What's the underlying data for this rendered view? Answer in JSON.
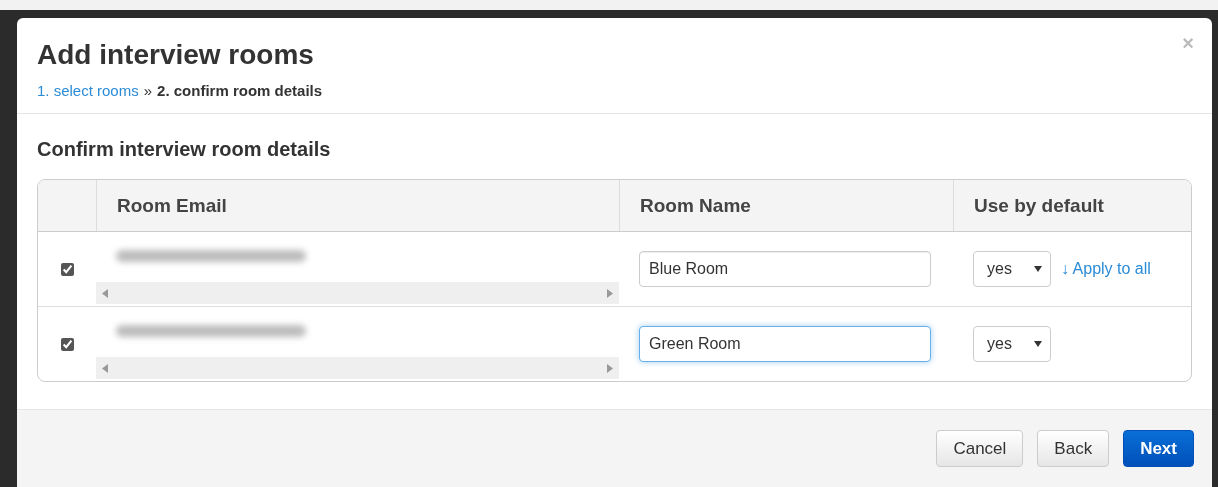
{
  "dialog": {
    "title": "Add interview rooms",
    "close": "×",
    "breadcrumb": [
      {
        "label": "1. select rooms",
        "kind": "link"
      },
      {
        "label": "»",
        "kind": "separator"
      },
      {
        "label": "2. confirm room details",
        "kind": "current"
      }
    ]
  },
  "section_title": "Confirm interview room details",
  "table": {
    "columns": [
      "Room Email",
      "Room Name",
      "Use by default"
    ],
    "rows": [
      {
        "checked": true,
        "room_name": "Blue Room",
        "name_focused": false,
        "use_by_default": "yes",
        "apply_link": "↓ Apply to all"
      },
      {
        "checked": true,
        "room_name": "Green Room",
        "name_focused": true,
        "use_by_default": "yes"
      }
    ]
  },
  "buttons": [
    {
      "label": "Cancel",
      "kind": "default"
    },
    {
      "label": "Back",
      "kind": "default"
    },
    {
      "label": "Next",
      "kind": "primary"
    }
  ]
}
